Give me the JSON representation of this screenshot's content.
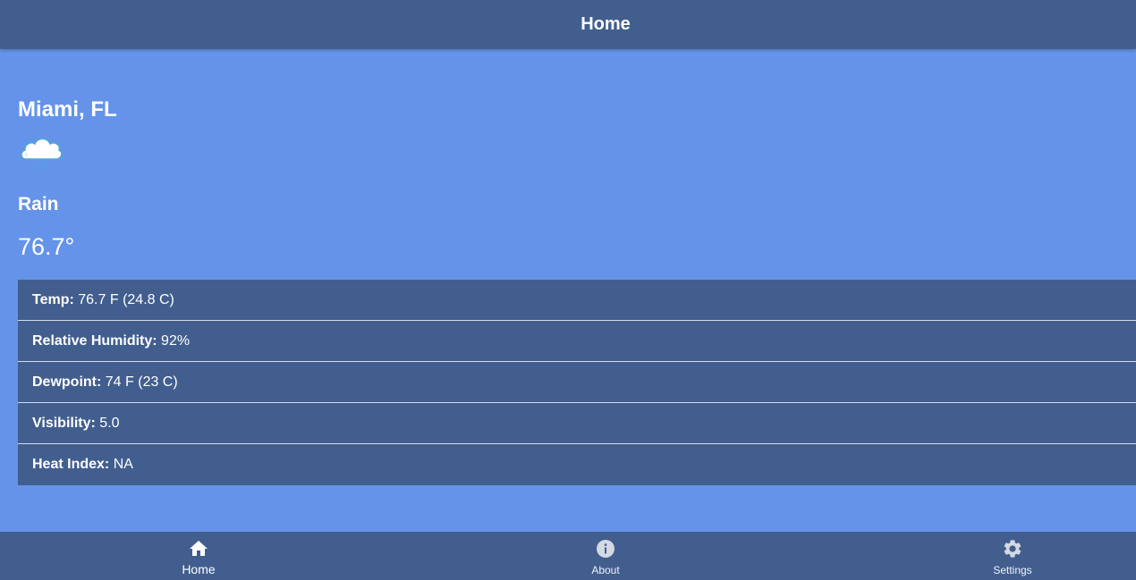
{
  "header": {
    "title": "Home"
  },
  "weather": {
    "location": "Miami, FL",
    "icon": "rain-cloud-icon",
    "condition": "Rain",
    "temperature": "76.7°"
  },
  "details": [
    {
      "label": "Temp:",
      "value": " 76.7 F (24.8 C)"
    },
    {
      "label": "Relative Humidity:",
      "value": " 92%"
    },
    {
      "label": "Dewpoint:",
      "value": " 74 F (23 C)"
    },
    {
      "label": "Visibility:",
      "value": " 5.0"
    },
    {
      "label": "Heat Index:",
      "value": " NA"
    }
  ],
  "nav": [
    {
      "label": "Home",
      "icon": "home-icon",
      "active": true
    },
    {
      "label": "About",
      "icon": "info-icon",
      "active": false
    },
    {
      "label": "Settings",
      "icon": "gear-icon",
      "active": false
    }
  ],
  "colors": {
    "page_background": "#6593ea",
    "bar_background": "#415e8e",
    "text": "#ffffff",
    "divider": "#d7dde8"
  }
}
